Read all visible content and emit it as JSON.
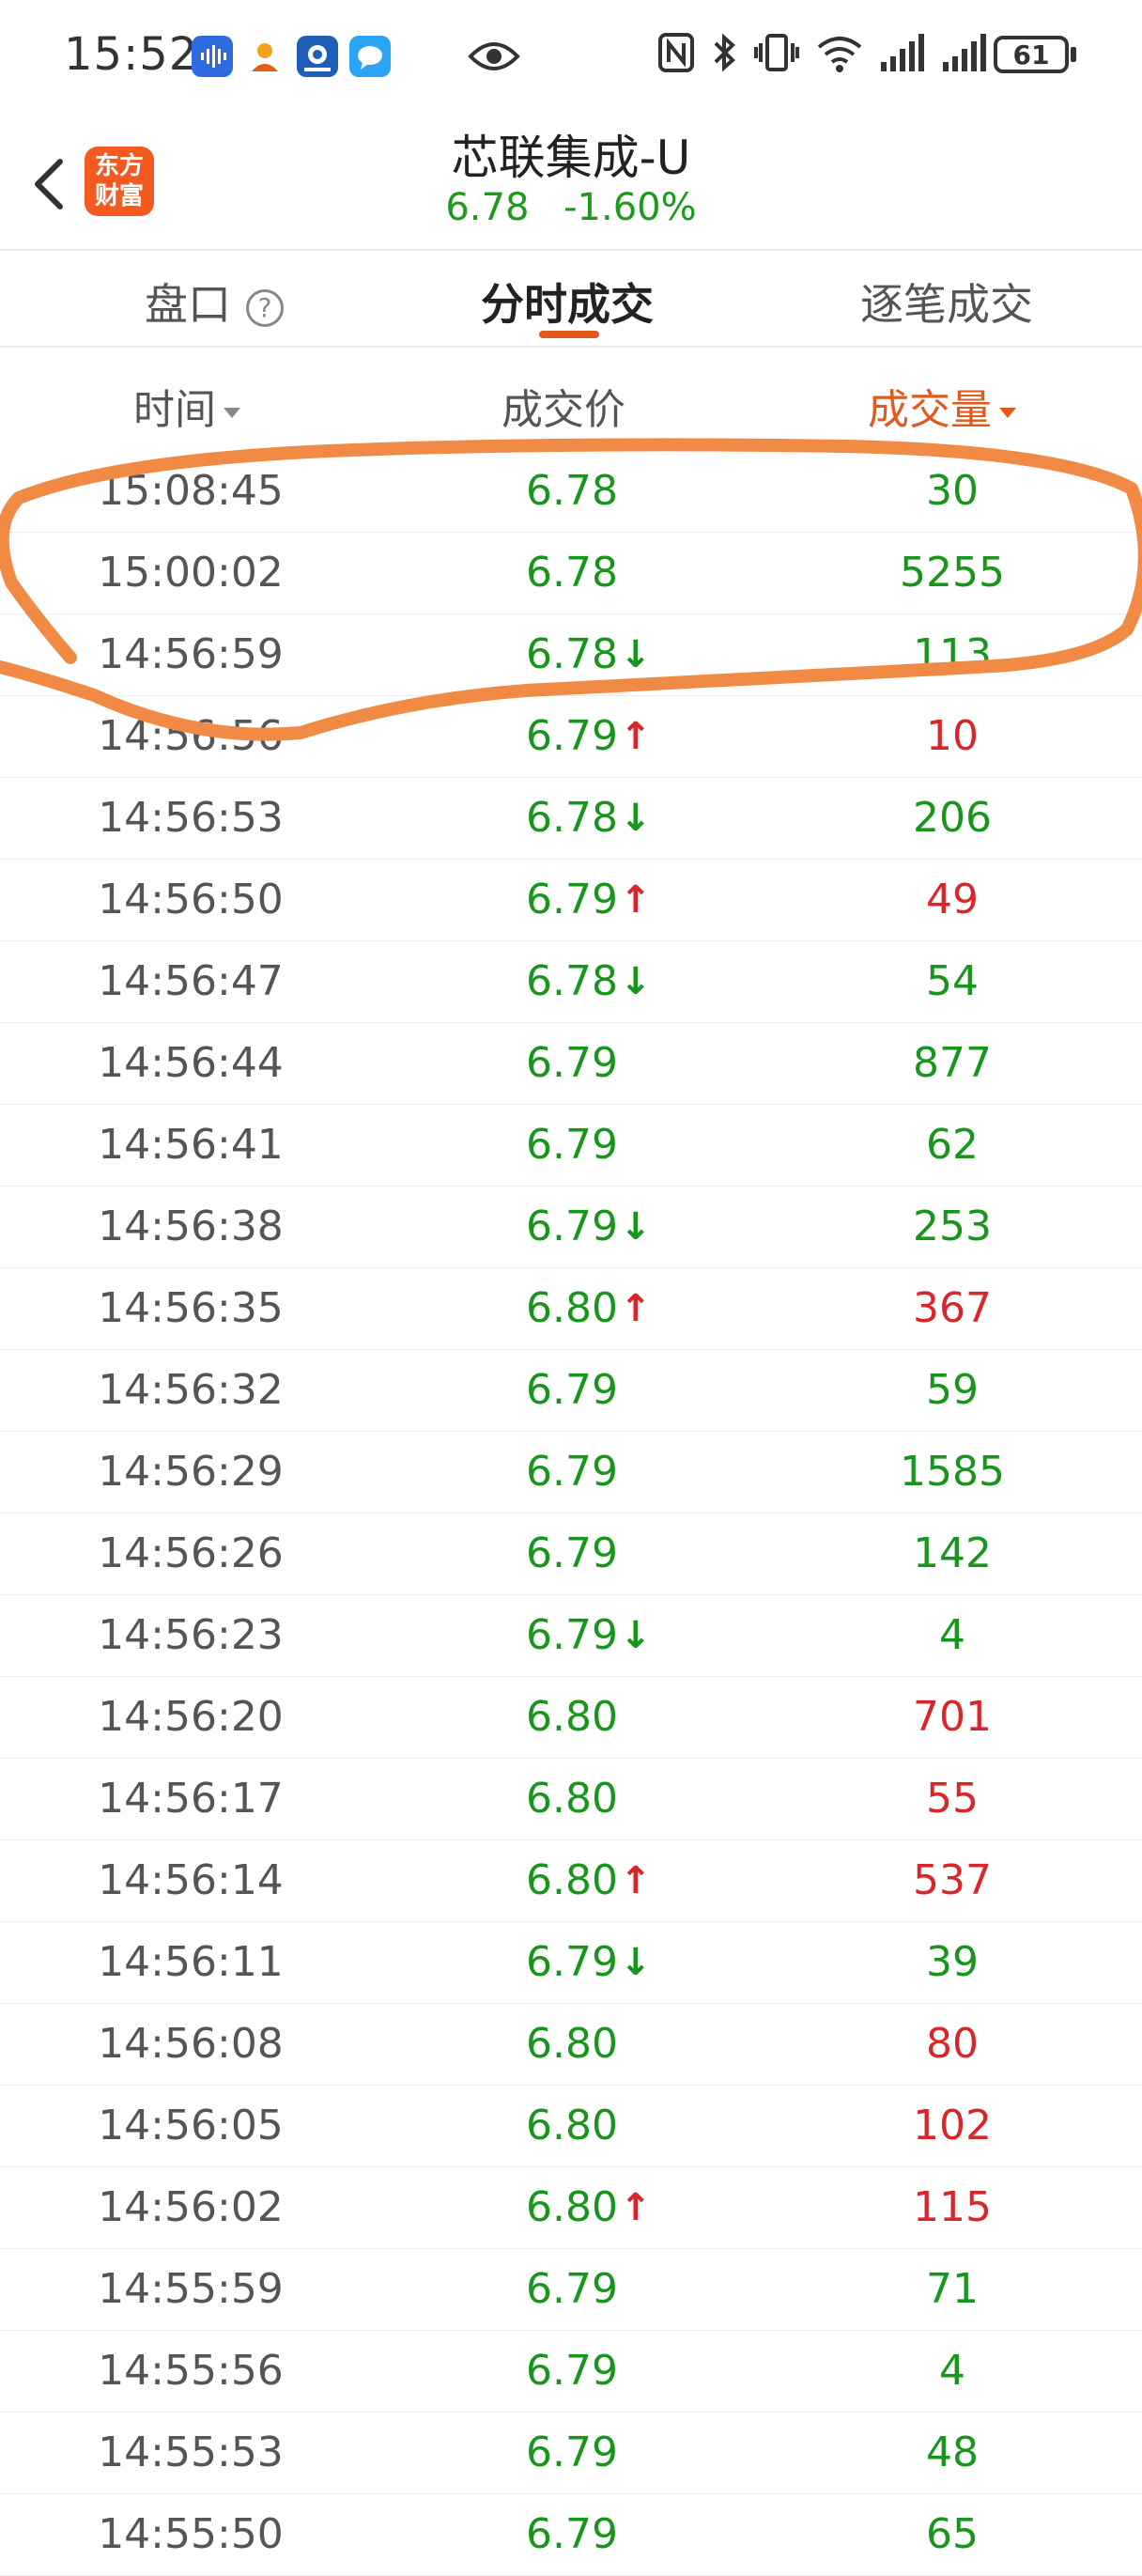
{
  "status_bar": {
    "time": "15:52",
    "battery": "61",
    "icons": [
      "voice-app-icon",
      "contact-app-icon",
      "bank-app-icon",
      "message-app-icon",
      "eye-icon",
      "nfc-icon",
      "bluetooth-icon",
      "vibrate-icon",
      "wifi-icon",
      "signal-icon",
      "signal-icon",
      "battery-icon"
    ]
  },
  "header": {
    "logo_line1": "东方",
    "logo_line2": "财富",
    "stock_name": "芯联集成-U",
    "price": "6.78",
    "change_pct": "-1.60%"
  },
  "tabs": [
    {
      "label": "盘口"
    },
    {
      "label": "分时成交"
    },
    {
      "label": "逐笔成交"
    }
  ],
  "columns": {
    "time": "时间",
    "price": "成交价",
    "volume": "成交量"
  },
  "colors": {
    "up": "#d9262a",
    "down": "#17961b",
    "accent": "#e2591c",
    "annotation": "#f08a45"
  },
  "trades": [
    {
      "time": "15:08:45",
      "price": "6.78",
      "arrow": "",
      "volume": "30",
      "dir": "down"
    },
    {
      "time": "15:00:02",
      "price": "6.78",
      "arrow": "",
      "volume": "5255",
      "dir": "down"
    },
    {
      "time": "14:56:59",
      "price": "6.78",
      "arrow": "↓",
      "volume": "113",
      "dir": "down"
    },
    {
      "time": "14:56:56",
      "price": "6.79",
      "arrow": "↑",
      "volume": "10",
      "dir": "up"
    },
    {
      "time": "14:56:53",
      "price": "6.78",
      "arrow": "↓",
      "volume": "206",
      "dir": "down"
    },
    {
      "time": "14:56:50",
      "price": "6.79",
      "arrow": "↑",
      "volume": "49",
      "dir": "up"
    },
    {
      "time": "14:56:47",
      "price": "6.78",
      "arrow": "↓",
      "volume": "54",
      "dir": "down"
    },
    {
      "time": "14:56:44",
      "price": "6.79",
      "arrow": "",
      "volume": "877",
      "dir": "down"
    },
    {
      "time": "14:56:41",
      "price": "6.79",
      "arrow": "",
      "volume": "62",
      "dir": "down"
    },
    {
      "time": "14:56:38",
      "price": "6.79",
      "arrow": "↓",
      "volume": "253",
      "dir": "down"
    },
    {
      "time": "14:56:35",
      "price": "6.80",
      "arrow": "↑",
      "volume": "367",
      "dir": "up"
    },
    {
      "time": "14:56:32",
      "price": "6.79",
      "arrow": "",
      "volume": "59",
      "dir": "down"
    },
    {
      "time": "14:56:29",
      "price": "6.79",
      "arrow": "",
      "volume": "1585",
      "dir": "down"
    },
    {
      "time": "14:56:26",
      "price": "6.79",
      "arrow": "",
      "volume": "142",
      "dir": "down"
    },
    {
      "time": "14:56:23",
      "price": "6.79",
      "arrow": "↓",
      "volume": "4",
      "dir": "down"
    },
    {
      "time": "14:56:20",
      "price": "6.80",
      "arrow": "",
      "volume": "701",
      "dir": "up"
    },
    {
      "time": "14:56:17",
      "price": "6.80",
      "arrow": "",
      "volume": "55",
      "dir": "up"
    },
    {
      "time": "14:56:14",
      "price": "6.80",
      "arrow": "↑",
      "volume": "537",
      "dir": "up"
    },
    {
      "time": "14:56:11",
      "price": "6.79",
      "arrow": "↓",
      "volume": "39",
      "dir": "down"
    },
    {
      "time": "14:56:08",
      "price": "6.80",
      "arrow": "",
      "volume": "80",
      "dir": "up"
    },
    {
      "time": "14:56:05",
      "price": "6.80",
      "arrow": "",
      "volume": "102",
      "dir": "up"
    },
    {
      "time": "14:56:02",
      "price": "6.80",
      "arrow": "↑",
      "volume": "115",
      "dir": "up"
    },
    {
      "time": "14:55:59",
      "price": "6.79",
      "arrow": "",
      "volume": "71",
      "dir": "down"
    },
    {
      "time": "14:55:56",
      "price": "6.79",
      "arrow": "",
      "volume": "4",
      "dir": "down"
    },
    {
      "time": "14:55:53",
      "price": "6.79",
      "arrow": "",
      "volume": "48",
      "dir": "down"
    },
    {
      "time": "14:55:50",
      "price": "6.79",
      "arrow": "",
      "volume": "65",
      "dir": "down"
    }
  ]
}
